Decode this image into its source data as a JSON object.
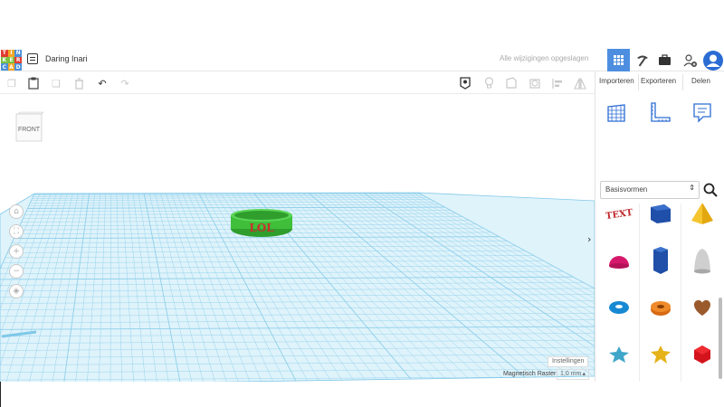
{
  "logo": {
    "letters": [
      "T",
      "I",
      "N",
      "K",
      "E",
      "R",
      "C",
      "A",
      "D"
    ],
    "colors": [
      "#e23b2e",
      "#f5a623",
      "#4a90d9",
      "#7ac143",
      "#7ac143",
      "#e23b2e",
      "#4a90d9",
      "#f5a623",
      "#4a90d9"
    ]
  },
  "header": {
    "project_title": "Daring Inari",
    "save_status": "Alle wijzigingen opgeslagen",
    "icons": [
      "grid-view-icon",
      "pickaxe-icon",
      "briefcase-icon",
      "add-user-icon",
      "avatar-icon"
    ]
  },
  "panel": {
    "tabs": {
      "import": "Importeren",
      "export": "Exporteren",
      "share": "Delen"
    },
    "category": "Basisvormen",
    "shapes": [
      "text-shape",
      "roof-shape",
      "pyramid-shape",
      "half-sphere-shape",
      "hexagonal-prism-shape",
      "paraboloid-shape",
      "torus-shape",
      "tube-shape",
      "heart-shape",
      "star-shape",
      "star-yellow-shape",
      "icosahedron-shape",
      "ring-shape",
      "cylinder-rounded-shape",
      "gem-shape"
    ]
  },
  "viewport": {
    "viewcube_label": "FRONT",
    "object_text": "LOL",
    "object_color": "#3fbf3a",
    "object_text_color": "#c9302c",
    "grid_color": "#7fc8e8",
    "settings_label": "Instellingen",
    "snap_label": "Magnetisch Raster",
    "snap_value": "1,0 mm"
  }
}
